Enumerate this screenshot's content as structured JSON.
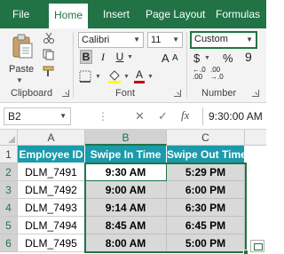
{
  "ribbon_tabs": [
    {
      "label": "File",
      "active": false
    },
    {
      "label": "Home",
      "active": true
    },
    {
      "label": "Insert",
      "active": false
    },
    {
      "label": "Page Layout",
      "active": false
    },
    {
      "label": "Formulas",
      "active": false
    }
  ],
  "clipboard": {
    "paste_label": "Paste",
    "group_label": "Clipboard",
    "icons": [
      "cut-icon",
      "copy-icon",
      "format-painter-icon"
    ]
  },
  "font": {
    "font_name": "Calibri",
    "font_size": "11",
    "group_label": "Font",
    "bold": "B",
    "italic": "I",
    "underline": "U",
    "grow_font": "A",
    "shrink_font": "A",
    "font_color_letter": "A",
    "font_color": "#c00000",
    "fill_color": "#ffff00"
  },
  "number": {
    "format": "Custom",
    "group_label": "Number",
    "currency_symbol": "$",
    "percent_symbol": "%",
    "comma_symbol": "9",
    "increase_decimal": "←.0\n.00",
    "decrease_decimal": ".00\n→.0"
  },
  "formula_bar": {
    "name_box": "B2",
    "fx_label": "fx",
    "cancel": "✕",
    "enter": "✓",
    "value": "9:30:00 AM"
  },
  "grid": {
    "columns": [
      "A",
      "B",
      "C"
    ],
    "rows": [
      "1",
      "2",
      "3",
      "4",
      "5",
      "6"
    ],
    "headers": [
      "Employee ID",
      "Swipe In Time",
      "Swipe Out Time"
    ],
    "data": [
      [
        "DLM_7491",
        "9:30 AM",
        "5:29 PM"
      ],
      [
        "DLM_7492",
        "9:00 AM",
        "6:00 PM"
      ],
      [
        "DLM_7493",
        "9:14 AM",
        "6:30 PM"
      ],
      [
        "DLM_7494",
        "8:45 AM",
        "6:45 PM"
      ],
      [
        "DLM_7495",
        "8:00 AM",
        "5:00 PM"
      ]
    ]
  },
  "colors": {
    "excel_green": "#217346",
    "header_fill": "#1b9aaa",
    "time_fill": "#d9d9d9"
  }
}
